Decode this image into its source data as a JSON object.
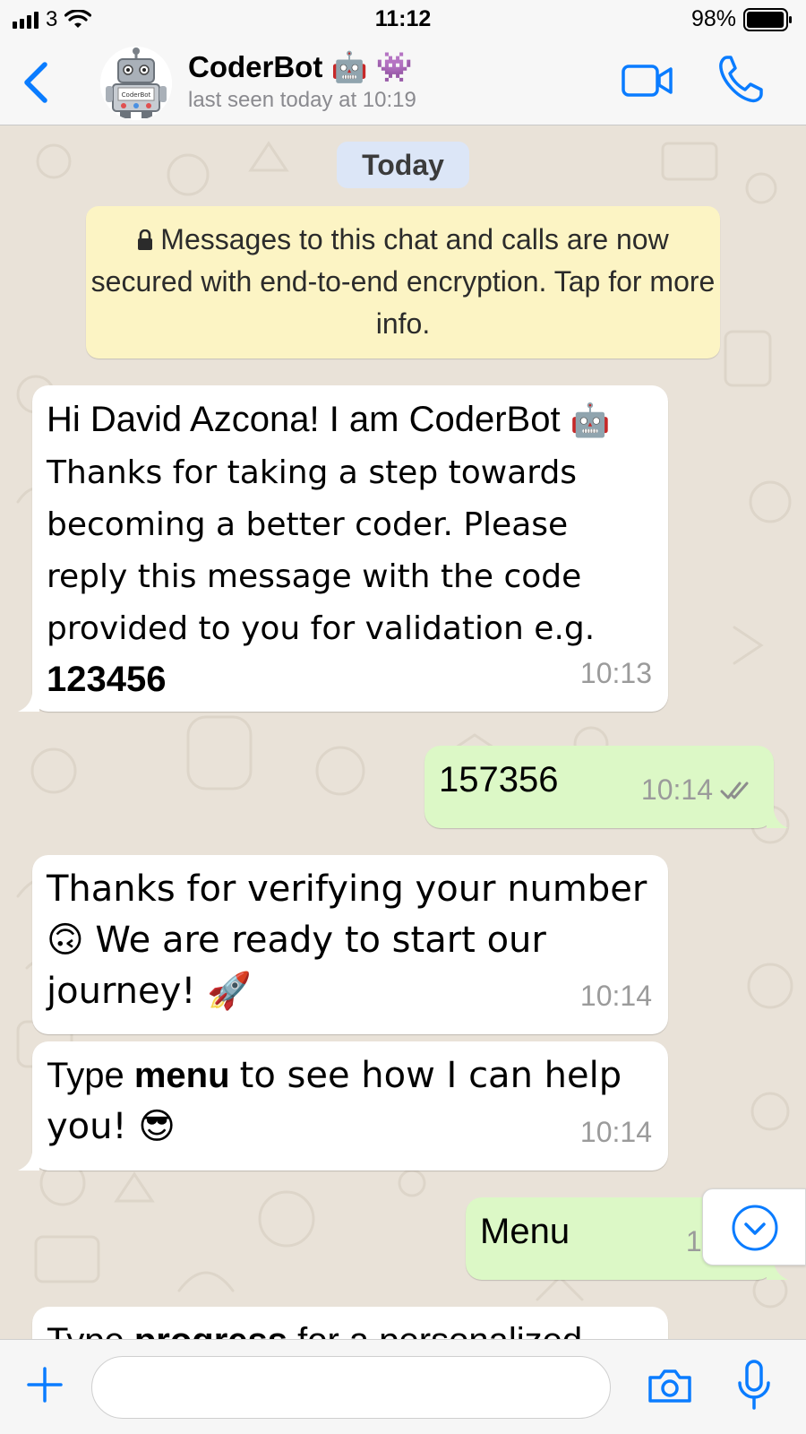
{
  "status_bar": {
    "carrier": "3",
    "time": "11:12",
    "battery": "98%",
    "battery_level": 0.98
  },
  "header": {
    "contact_name": "CoderBot 🤖 👾",
    "last_seen": "last seen today at 10:19",
    "avatar_label": "CoderBot"
  },
  "chat": {
    "date_label": "Today",
    "encryption_notice": "Messages to this chat and calls are now secured with end-to-end encryption. Tap for more info.",
    "messages": [
      {
        "direction": "in",
        "text_1": "Hi David Azcona! I am CoderBot",
        "text_2": "🤖 Thanks for taking a step towards becoming a better coder. Please reply this message with the code provided to you for validation e.g.",
        "text_bold": "123456",
        "time": "10:13"
      },
      {
        "direction": "out",
        "text": "157356",
        "time": "10:14",
        "status": "read"
      },
      {
        "direction": "in",
        "text": "Thanks for verifying your number 🙃 We are ready to start our journey! 🚀",
        "time": "10:14"
      },
      {
        "direction": "in",
        "text_before": "Type",
        "text_bold": "menu",
        "text_after": "to see how I can help you! 😎",
        "time": "10:14"
      },
      {
        "direction": "out",
        "text": "Menu",
        "time": "10:14"
      },
      {
        "direction": "in",
        "text_before": "Type",
        "text_bold": "progress",
        "text_after": "for a personalized"
      }
    ]
  },
  "input_bar": {
    "placeholder": ""
  },
  "icons": {
    "back": "chevron-left-icon",
    "video": "video-camera-icon",
    "call": "phone-icon",
    "plus": "plus-icon",
    "camera": "camera-icon",
    "mic": "microphone-icon",
    "scroll": "chevron-down-circle-icon",
    "read_receipt": "double-check-icon",
    "lock": "lock-icon"
  },
  "colors": {
    "accent": "#0a7cff",
    "incoming_bubble": "#ffffff",
    "outgoing_bubble": "#dcf8c6",
    "chat_background": "#e9e2d8",
    "encryption_bg": "#fcf4c4",
    "date_pill_bg": "#dce6f7"
  }
}
